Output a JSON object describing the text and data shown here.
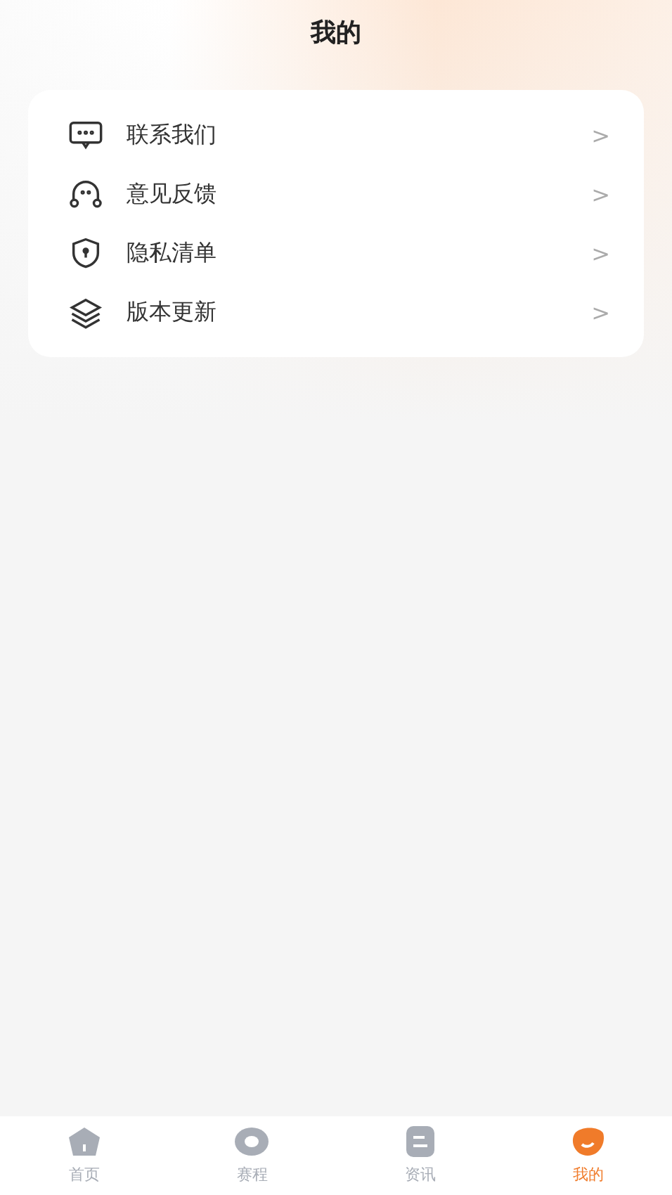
{
  "header": {
    "title": "我的"
  },
  "menu": [
    {
      "kind": "chat",
      "label": "联系我们",
      "chevron": ">"
    },
    {
      "kind": "headset",
      "label": "意见反馈",
      "chevron": ">"
    },
    {
      "kind": "shield",
      "label": "隐私清单",
      "chevron": ">"
    },
    {
      "kind": "layers",
      "label": "版本更新",
      "chevron": ">"
    }
  ],
  "tabs": [
    {
      "kind": "home",
      "label": "首页",
      "selected": false
    },
    {
      "kind": "ring",
      "label": "赛程",
      "selected": false
    },
    {
      "kind": "news",
      "label": "资讯",
      "selected": false
    },
    {
      "kind": "me",
      "label": "我的",
      "selected": true
    }
  ]
}
